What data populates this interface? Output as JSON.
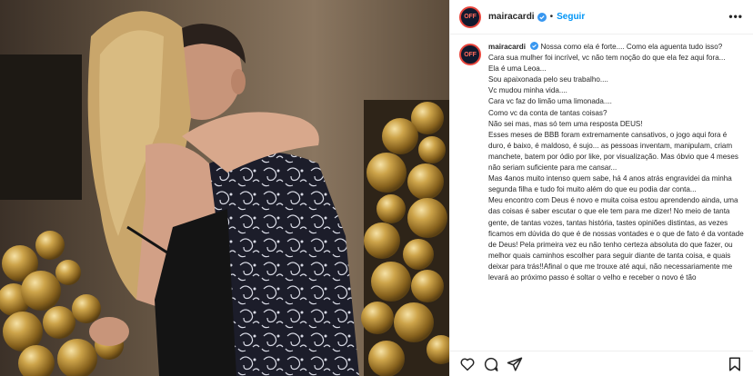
{
  "post": {
    "username": "mairacardi",
    "follow_label": "Seguir",
    "separator": "•",
    "more_label": "•••",
    "avatar_text": "OFF"
  },
  "caption": {
    "username": "mairacardi",
    "lines": [
      "Nossa como ela é forte.... Como ela aguenta tudo isso?",
      "Cara sua mulher foi incrível, vc não tem noção do que ela fez aqui fora...",
      "Ela é uma Leoa...",
      "Sou apaixonada pelo seu trabalho....",
      "Vc mudou minha vida....",
      "Cara vc faz do limão uma limonada....",
      "Como vc da conta de tantas coisas?",
      "Não sei mas, mas só tem uma resposta DEUS!",
      "Esses meses de BBB foram extremamente cansativos, o jogo aqui fora é duro, é baixo, é maldoso, é sujo... as pessoas inventam, manipulam, criam manchete, batem por ódio por like, por visualização. Mas óbvio que 4 meses não seriam suficiente para me cansar...",
      "Mas 4anos muito intenso quem sabe, há 4 anos atrás engravidei da minha segunda filha e tudo foi muito além do que eu podia dar conta...",
      "Meu encontro com Deus é novo e muita coisa estou aprendendo ainda, uma das coisas é saber escutar o que ele tem para me dizer! No meio de tanta gente, de tantas vozes, tantas história, tastes opiniões distintas, as vezes ficamos em dúvida do que é de nossas vontades e o que de fato é da vontade de Deus! Pela primeira vez eu não tenho certeza absoluta do que fazer, ou melhor quais caminhos escolher para seguir diante de tanta coisa, e quais deixar para trás!!Afinal o que me trouxe até aqui, não necessariamente me levará ao próximo passo é soltar o velho e receber o novo é tão"
    ]
  },
  "actions": {
    "like_icon": "heart-icon",
    "comment_icon": "comment-icon",
    "share_icon": "share-icon",
    "save_icon": "bookmark-icon"
  },
  "colors": {
    "link": "#0095f6",
    "verified": "#3897f0",
    "text": "#262626"
  }
}
